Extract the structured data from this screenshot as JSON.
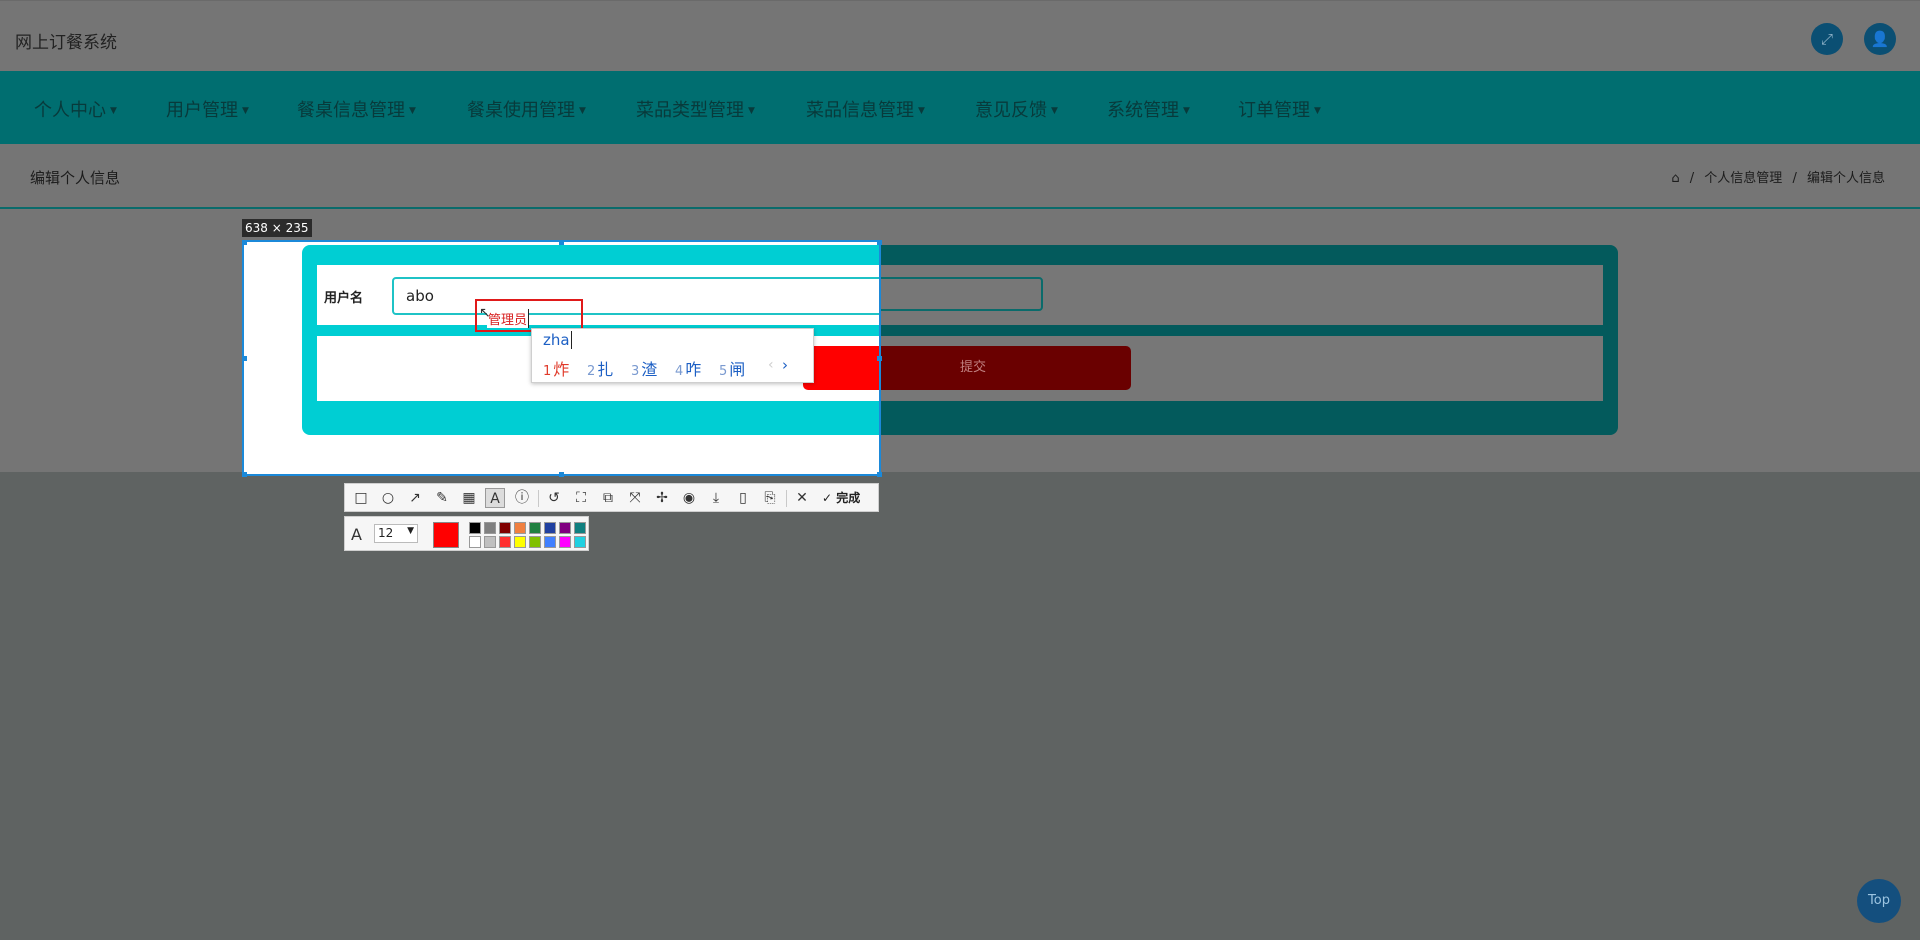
{
  "app": {
    "title": "网上订餐系统"
  },
  "header": {
    "fullscreen_icon": "expand-icon",
    "user_icon": "user-icon"
  },
  "nav": {
    "items": [
      "个人中心",
      "用户管理",
      "餐桌信息管理",
      "餐桌使用管理",
      "菜品类型管理",
      "菜品信息管理",
      "意见反馈",
      "系统管理",
      "订单管理"
    ]
  },
  "subheader": {
    "title": "编辑个人信息",
    "breadcrumb": [
      "个人信息管理",
      "编辑个人信息"
    ],
    "home_icon": "home-icon"
  },
  "form": {
    "username_label": "用户名",
    "username_value": "abo",
    "submit_label": "提交"
  },
  "capture": {
    "size_label": "638 × 235",
    "annotation_text": "管理员",
    "ime": {
      "composition": "zha",
      "candidates": [
        {
          "num": "1",
          "text": "炸"
        },
        {
          "num": "2",
          "text": "扎"
        },
        {
          "num": "3",
          "text": "渣"
        },
        {
          "num": "4",
          "text": "咋"
        },
        {
          "num": "5",
          "text": "闸"
        }
      ]
    },
    "toolbar": {
      "tools": [
        "rectangle-icon",
        "ellipse-icon",
        "arrow-icon",
        "pencil-icon",
        "mosaic-icon",
        "text-icon",
        "number-marker-icon",
        "undo-icon",
        "ocr-icon",
        "translate-icon",
        "scroll-capture-icon",
        "pin-icon",
        "record-icon",
        "download-icon",
        "save-device-icon",
        "bookmark-icon"
      ],
      "done_label": "完成"
    },
    "style": {
      "font_size": "12",
      "current_color": "#ff0000",
      "palette": [
        "#000000",
        "#808080",
        "#800000",
        "#f08040",
        "#208040",
        "#2040a0",
        "#800080",
        "#108080",
        "#ffffff",
        "#c0c0c0",
        "#ff3030",
        "#ffff00",
        "#80c000",
        "#4080ff",
        "#ff00ff",
        "#20d0e0"
      ]
    }
  },
  "back_to_top": "Top"
}
